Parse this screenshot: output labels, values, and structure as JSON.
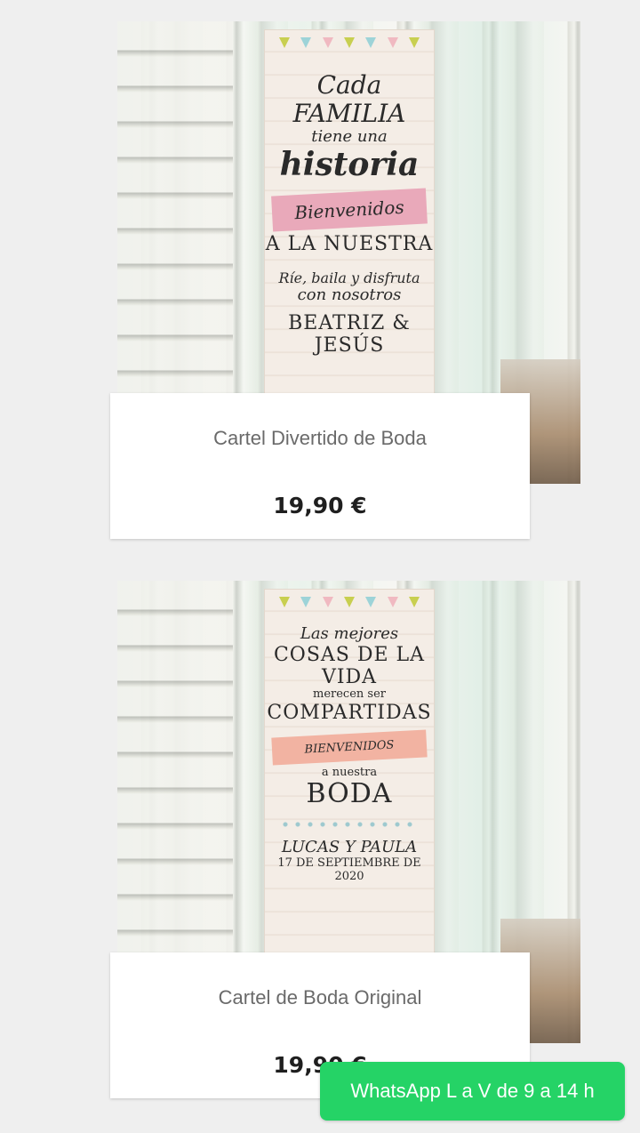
{
  "products": [
    {
      "name": "Cartel Divertido de Boda",
      "price": "19,90 €",
      "poster": {
        "line1": "Cada FAMILIA",
        "line2": "tiene una",
        "line3": "historia",
        "ribbon": "Bienvenidos",
        "line4": "A LA NUESTRA",
        "line5": "Ríe, baila y disfruta",
        "line6": "con nosotros",
        "line7": "BEATRIZ & JESÚS"
      }
    },
    {
      "name": "Cartel de Boda Original",
      "price": "19,90 €",
      "poster": {
        "line1": "Las mejores",
        "line2": "COSAS DE LA VIDA",
        "line3": "merecen ser",
        "line4": "COMPARTIDAS",
        "ribbon": "BIENVENIDOS",
        "line5": "a nuestra",
        "line6": "BODA",
        "line7": "LUCAS Y PAULA",
        "line8": "17 DE SEPTIEMBRE DE 2020"
      }
    }
  ],
  "whatsapp": {
    "label": "WhatsApp L a V de 9 a 14 h",
    "color": "#25d366"
  }
}
